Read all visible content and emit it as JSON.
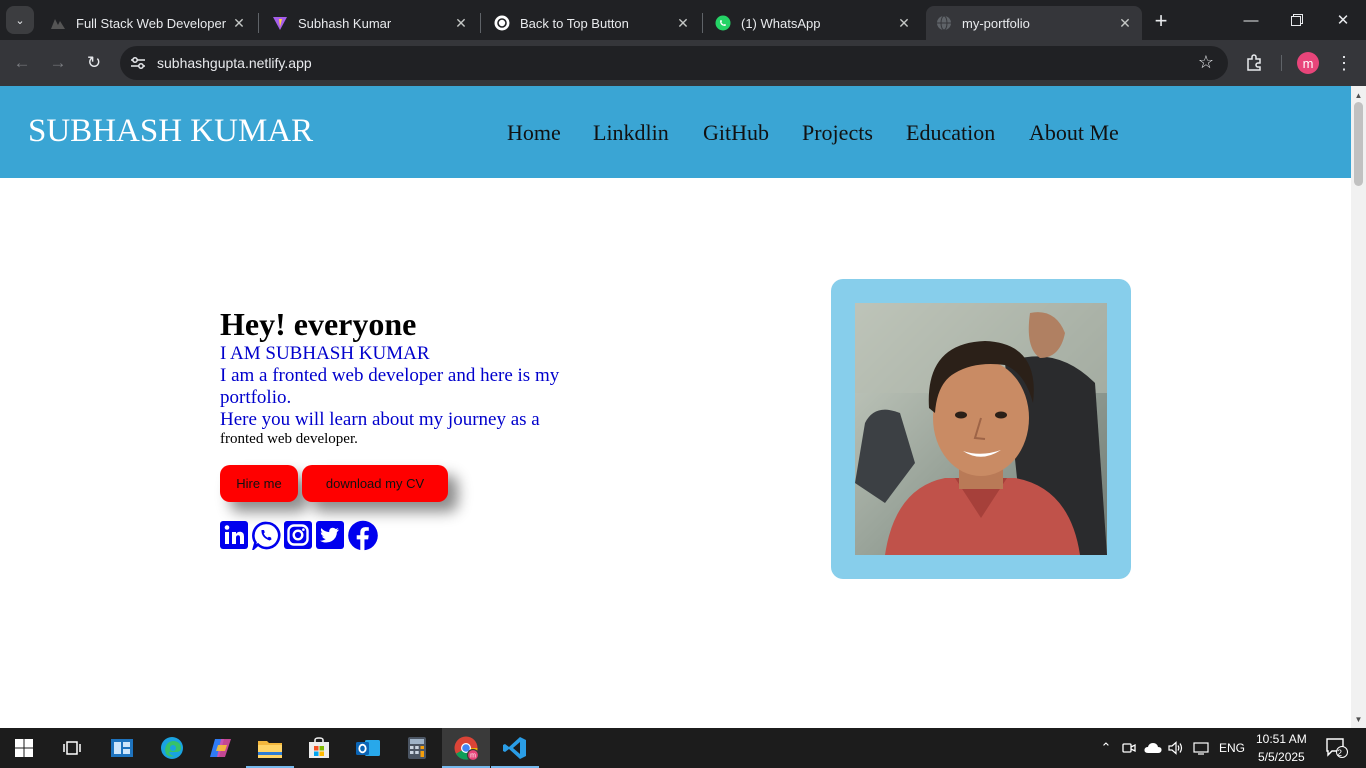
{
  "browser": {
    "tabs": [
      {
        "title": "Full Stack Web Developer",
        "icon": "dev-site-favicon"
      },
      {
        "title": "Subhash Kumar",
        "icon": "vite-favicon"
      },
      {
        "title": "Back to Top Button",
        "icon": "chatgpt-favicon"
      },
      {
        "title": "(1) WhatsApp",
        "icon": "whatsapp-favicon"
      },
      {
        "title": "my-portfolio",
        "icon": "globe-favicon",
        "active": true
      }
    ],
    "url": "subhashgupta.netlify.app",
    "profile_initial": "m"
  },
  "site": {
    "brand": "SUBHASH KUMAR",
    "nav": [
      "Home",
      "Linkdlin",
      "GitHub",
      "Projects",
      "Education",
      "About Me"
    ],
    "hero": {
      "title": "Hey! everyone",
      "line1": "I AM SUBHASH KUMAR",
      "line2": "I am a fronted web developer and here is my portfolio.",
      "line3": "Here you will learn about my journey as a",
      "line4": "fronted web developer."
    },
    "buttons": {
      "hire": "Hire me",
      "cv": "download my CV"
    },
    "social": [
      "linkedin-icon",
      "whatsapp-icon",
      "instagram-icon",
      "twitter-icon",
      "facebook-icon"
    ],
    "colors": {
      "header": "#3aa5d4",
      "button": "#ff0000",
      "frame": "#87ceeb",
      "link_text": "#0000cc"
    }
  },
  "taskbar": {
    "apps": [
      "start-icon",
      "task-view-icon",
      "widgets-icon",
      "edge-icon",
      "copilot-icon",
      "file-explorer-icon",
      "store-icon",
      "outlook-icon",
      "calculator-icon",
      "chrome-icon",
      "vscode-icon"
    ],
    "language": "ENG",
    "time": "10:51 AM",
    "date": "5/5/2025",
    "notifications": "2"
  }
}
